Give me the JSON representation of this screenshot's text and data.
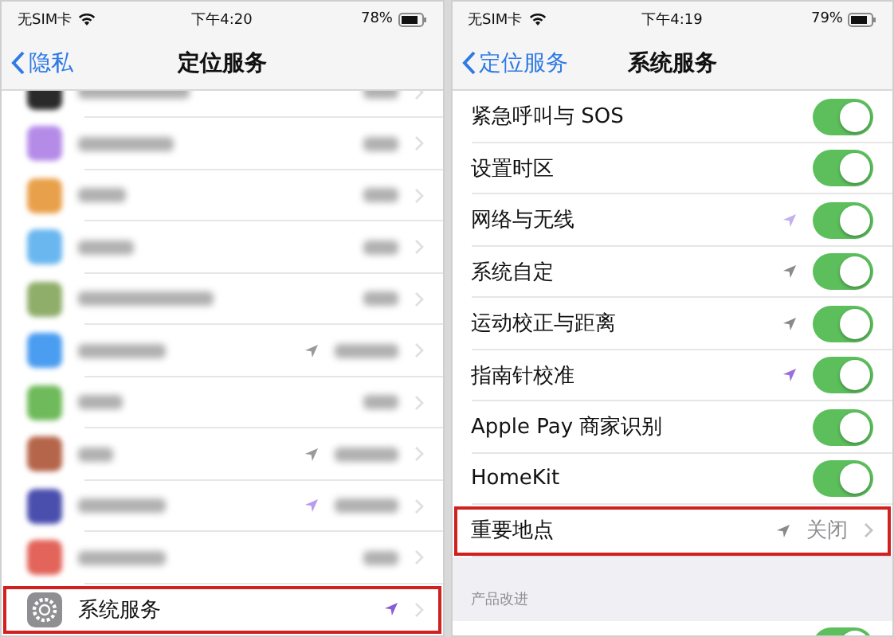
{
  "left_phone": {
    "status_bar": {
      "carrier": "无SIM卡",
      "time": "下午4:20",
      "battery": "78%"
    },
    "nav": {
      "back": "隐私",
      "title": "定位服务"
    },
    "apps": [
      {
        "color": "#2a2a2a"
      },
      {
        "color": "#b58be8"
      },
      {
        "color": "#e9a04a"
      },
      {
        "color": "#6ab7ef"
      },
      {
        "color": "#8fae6a"
      },
      {
        "color": "#4a9df0",
        "arrow": {
          "color": "#9a9a9a"
        }
      },
      {
        "color": "#6fba5a"
      },
      {
        "color": "#b5654a",
        "arrow": {
          "color": "#9a9a9a"
        }
      },
      {
        "color": "#4a4fae",
        "arrow": {
          "color": "#b99af0"
        }
      },
      {
        "color": "#e2645a"
      }
    ],
    "system_services": {
      "label": "系统服务",
      "arrow": {
        "color": "#8a5cd8"
      },
      "highlighted": true
    }
  },
  "right_phone": {
    "status_bar": {
      "carrier": "无SIM卡",
      "time": "下午4:19",
      "battery": "79%"
    },
    "nav": {
      "back": "定位服务",
      "title": "系统服务"
    },
    "rows": [
      {
        "kind": "toggle",
        "label": "紧急呼叫与 SOS",
        "on": true
      },
      {
        "kind": "toggle",
        "label": "设置时区",
        "on": true
      },
      {
        "kind": "toggle",
        "label": "网络与无线",
        "on": true,
        "arrow": {
          "color": "#c4b0ec"
        }
      },
      {
        "kind": "toggle",
        "label": "系统自定",
        "on": true,
        "arrow": {
          "color": "#8a8a8a"
        }
      },
      {
        "kind": "toggle",
        "label": "运动校正与距离",
        "on": true,
        "arrow": {
          "color": "#8a8a8a"
        }
      },
      {
        "kind": "toggle",
        "label": "指南针校准",
        "on": true,
        "arrow": {
          "color": "#9b6fe0"
        }
      },
      {
        "kind": "toggle",
        "label": "Apple Pay 商家识别",
        "on": true
      },
      {
        "kind": "toggle",
        "label": "HomeKit",
        "on": true
      },
      {
        "kind": "link",
        "label": "重要地点",
        "value": "关闭",
        "arrow": {
          "color": "#8a8a8a"
        },
        "highlighted": true
      }
    ],
    "section": {
      "header": "产品改进",
      "rows": [
        {
          "on": true
        }
      ]
    }
  }
}
